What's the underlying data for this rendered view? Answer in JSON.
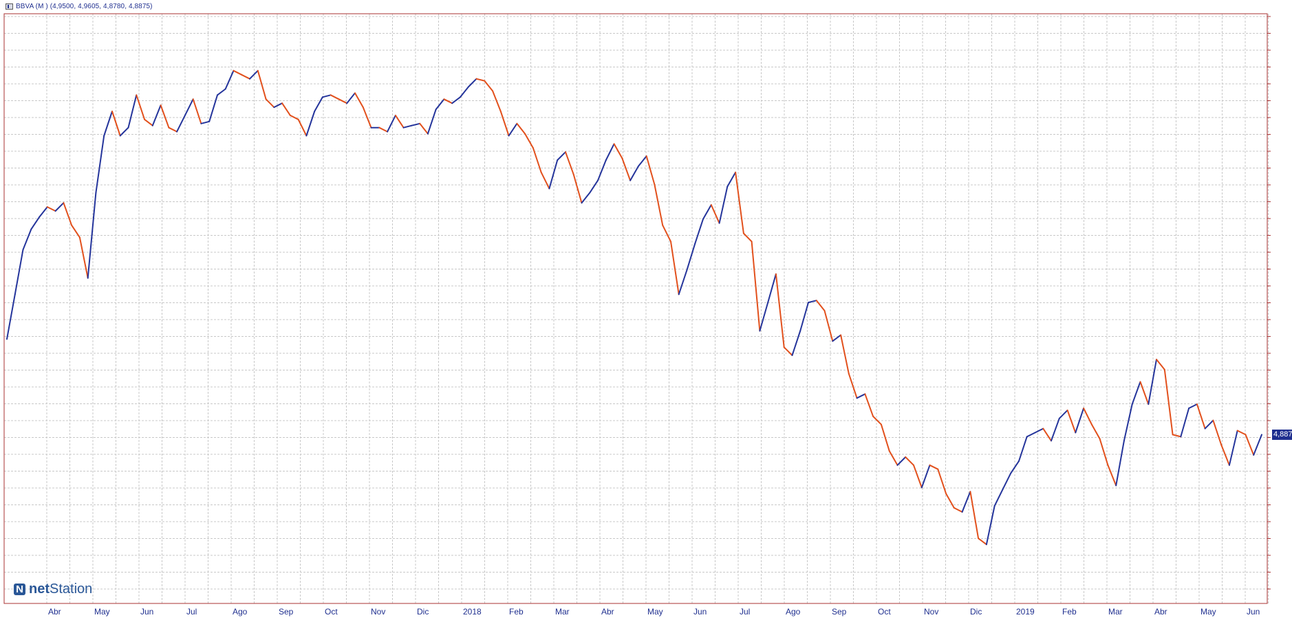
{
  "header": {
    "instrument_label": "BBVA (M ) (4,9500, 4,9605, 4,8780, 4,8875)"
  },
  "brand": {
    "mark": "N",
    "name_bold": "net",
    "name_regular": "Station"
  },
  "last_price_label": "4,887",
  "colors": {
    "up": "#24349b",
    "down": "#e2501c",
    "grid": "#c8c8c8",
    "frame": "#a83232",
    "axis_text": "#1f2f8f",
    "background": "#ffffff"
  },
  "chart_data": {
    "type": "line",
    "series": [
      {
        "values": [
          4.8,
          5.02,
          5.24,
          5.34,
          5.4,
          5.45,
          5.43,
          5.47,
          5.36,
          5.3,
          5.1,
          5.52,
          5.8,
          5.92,
          5.8,
          5.84,
          6.0,
          5.88,
          5.85,
          5.95,
          5.84,
          5.82,
          5.9,
          5.98,
          5.86,
          5.87,
          6.0,
          6.03,
          6.12,
          6.1,
          6.08,
          6.12,
          5.98,
          5.94,
          5.96,
          5.9,
          5.88,
          5.8,
          5.92,
          5.99,
          6.0,
          5.98,
          5.96,
          6.01,
          5.94,
          5.84,
          5.84,
          5.82,
          5.9,
          5.84,
          5.85,
          5.86,
          5.81,
          5.93,
          5.98,
          5.96,
          5.99,
          6.04,
          6.08,
          6.07,
          6.02,
          5.92,
          5.8,
          5.86,
          5.81,
          5.74,
          5.62,
          5.54,
          5.68,
          5.72,
          5.61,
          5.47,
          5.52,
          5.58,
          5.68,
          5.76,
          5.69,
          5.58,
          5.65,
          5.7,
          5.56,
          5.36,
          5.28,
          5.02,
          5.14,
          5.27,
          5.39,
          5.46,
          5.37,
          5.55,
          5.62,
          5.32,
          5.28,
          4.84,
          4.98,
          5.12,
          4.76,
          4.72,
          4.84,
          4.98,
          4.99,
          4.94,
          4.79,
          4.82,
          4.63,
          4.51,
          4.53,
          4.42,
          4.38,
          4.25,
          4.18,
          4.22,
          4.18,
          4.07,
          4.18,
          4.16,
          4.04,
          3.97,
          3.95,
          4.05,
          3.82,
          3.79,
          3.98,
          4.06,
          4.14,
          4.2,
          4.32,
          4.34,
          4.36,
          4.3,
          4.41,
          4.45,
          4.34,
          4.46,
          4.38,
          4.31,
          4.18,
          4.08,
          4.3,
          4.48,
          4.59,
          4.48,
          4.7,
          4.65,
          4.33,
          4.32,
          4.46,
          4.48,
          4.36,
          4.4,
          4.28,
          4.18,
          4.35,
          4.33,
          4.23,
          4.33
        ]
      }
    ],
    "x_ticks": [
      "Abr",
      "May",
      "Jun",
      "Jul",
      "Ago",
      "Sep",
      "Oct",
      "Nov",
      "Dic",
      "2018",
      "Feb",
      "Mar",
      "Abr",
      "May",
      "Jun",
      "Jul",
      "Ago",
      "Sep",
      "Oct",
      "Nov",
      "Dic",
      "2019",
      "Feb",
      "Mar",
      "Abr",
      "May",
      "Jun"
    ],
    "ylim": [
      3.5,
      6.4
    ],
    "grid": true,
    "legend": "none"
  }
}
